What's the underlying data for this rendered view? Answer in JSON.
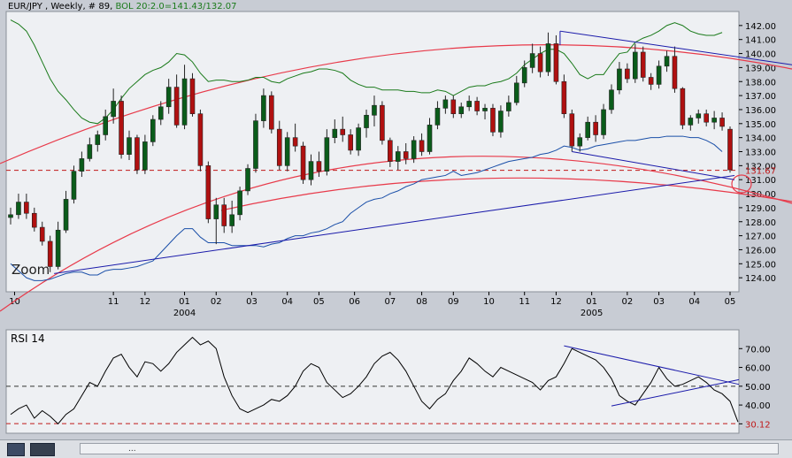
{
  "header": {
    "symbol_text": "EUR/JPY , Weekly, # 89,",
    "bol_text": "BOL 20:2.0=141.43/132.07"
  },
  "zoom_label": "Zoom",
  "rsi_title": "RSI 14",
  "colors": {
    "up": "#0a5c1a",
    "down": "#b01010",
    "bollinger_upper": "#1a7a1a",
    "bollinger_lower": "#1a4fa8",
    "trendline": "#1a1aaa",
    "arc": "#e83a4a",
    "level": "#c01818"
  },
  "taskbar": {
    "dots": "..."
  },
  "chart_data": [
    {
      "type": "candlestick",
      "title": "EUR/JPY , Weekly, # 89,",
      "indicator": "BOL 20:2.0=141.43/132.07",
      "ylim": [
        123,
        143
      ],
      "yticks": [
        124,
        125,
        126,
        127,
        128,
        129,
        130,
        131,
        132,
        133,
        134,
        135,
        136,
        137,
        138,
        139,
        140,
        141,
        142
      ],
      "ytick_labels": [
        "124.00",
        "125.00",
        "126.00",
        "127.00",
        "128.00",
        "129.00",
        "130.00",
        "131.00",
        "132.00",
        "133.00",
        "134.00",
        "135.00",
        "136.00",
        "137.00",
        "138.00",
        "139.00",
        "140.00",
        "141.00",
        "142.00"
      ],
      "xtick_labels": [
        "10",
        "11",
        "12",
        "01",
        "02",
        "03",
        "04",
        "05",
        "06",
        "07",
        "08",
        "09",
        "10",
        "11",
        "12",
        "01",
        "02",
        "03",
        "04",
        "05"
      ],
      "xtick_weeks": [
        0.5,
        13,
        17,
        22,
        26,
        30.5,
        35,
        39,
        43.5,
        48,
        52,
        56,
        60.5,
        65,
        69,
        73.5,
        78,
        82,
        86.5,
        91
      ],
      "year_labels": [
        {
          "text": "2004",
          "week": 22
        },
        {
          "text": "2005",
          "week": 73.5
        }
      ],
      "current_label": "131.67",
      "current_level": 131.67,
      "candles": [
        {
          "o": 128.3,
          "h": 129.0,
          "l": 127.8,
          "c": 128.5
        },
        {
          "o": 128.5,
          "h": 130.0,
          "l": 128.2,
          "c": 129.4
        },
        {
          "o": 129.4,
          "h": 130.0,
          "l": 128.2,
          "c": 128.6
        },
        {
          "o": 128.6,
          "h": 129.0,
          "l": 127.3,
          "c": 127.6
        },
        {
          "o": 127.6,
          "h": 128.0,
          "l": 126.3,
          "c": 126.6
        },
        {
          "o": 126.6,
          "h": 127.0,
          "l": 124.4,
          "c": 124.8
        },
        {
          "o": 124.8,
          "h": 128.0,
          "l": 124.6,
          "c": 127.4
        },
        {
          "o": 127.4,
          "h": 130.2,
          "l": 127.2,
          "c": 129.6
        },
        {
          "o": 129.6,
          "h": 132.0,
          "l": 129.3,
          "c": 131.6
        },
        {
          "o": 131.6,
          "h": 133.0,
          "l": 131.2,
          "c": 132.5
        },
        {
          "o": 132.5,
          "h": 134.0,
          "l": 132.3,
          "c": 133.5
        },
        {
          "o": 133.5,
          "h": 134.5,
          "l": 133.0,
          "c": 134.2
        },
        {
          "o": 134.2,
          "h": 136.0,
          "l": 133.8,
          "c": 135.5
        },
        {
          "o": 135.5,
          "h": 137.5,
          "l": 135.0,
          "c": 136.6
        },
        {
          "o": 136.6,
          "h": 137.0,
          "l": 132.5,
          "c": 132.8
        },
        {
          "o": 132.8,
          "h": 134.5,
          "l": 132.4,
          "c": 134.0
        },
        {
          "o": 134.0,
          "h": 134.2,
          "l": 131.4,
          "c": 131.7
        },
        {
          "o": 131.7,
          "h": 134.2,
          "l": 131.4,
          "c": 133.7
        },
        {
          "o": 133.7,
          "h": 135.6,
          "l": 133.4,
          "c": 135.3
        },
        {
          "o": 135.3,
          "h": 136.6,
          "l": 134.9,
          "c": 136.2
        },
        {
          "o": 136.2,
          "h": 138.2,
          "l": 135.7,
          "c": 137.6
        },
        {
          "o": 137.6,
          "h": 138.5,
          "l": 134.7,
          "c": 134.9
        },
        {
          "o": 134.9,
          "h": 139.2,
          "l": 134.6,
          "c": 138.2
        },
        {
          "o": 138.2,
          "h": 138.6,
          "l": 135.5,
          "c": 135.7
        },
        {
          "o": 135.7,
          "h": 136.0,
          "l": 131.6,
          "c": 132.0
        },
        {
          "o": 132.0,
          "h": 132.3,
          "l": 127.9,
          "c": 128.2
        },
        {
          "o": 128.2,
          "h": 129.7,
          "l": 126.4,
          "c": 129.2
        },
        {
          "o": 129.2,
          "h": 129.7,
          "l": 127.2,
          "c": 127.7
        },
        {
          "o": 127.7,
          "h": 129.5,
          "l": 127.2,
          "c": 128.5
        },
        {
          "o": 128.5,
          "h": 130.5,
          "l": 128.1,
          "c": 130.2
        },
        {
          "o": 130.2,
          "h": 132.1,
          "l": 129.9,
          "c": 131.8
        },
        {
          "o": 131.8,
          "h": 135.7,
          "l": 131.5,
          "c": 135.2
        },
        {
          "o": 135.2,
          "h": 137.5,
          "l": 134.7,
          "c": 137.0
        },
        {
          "o": 137.0,
          "h": 137.3,
          "l": 134.3,
          "c": 134.6
        },
        {
          "o": 134.6,
          "h": 135.2,
          "l": 131.7,
          "c": 132.0
        },
        {
          "o": 132.0,
          "h": 134.4,
          "l": 131.6,
          "c": 134.0
        },
        {
          "o": 134.0,
          "h": 135.0,
          "l": 133.0,
          "c": 133.4
        },
        {
          "o": 133.4,
          "h": 133.7,
          "l": 130.7,
          "c": 131.0
        },
        {
          "o": 131.0,
          "h": 132.8,
          "l": 130.6,
          "c": 132.3
        },
        {
          "o": 132.3,
          "h": 133.0,
          "l": 131.2,
          "c": 131.6
        },
        {
          "o": 131.6,
          "h": 134.6,
          "l": 131.3,
          "c": 134.0
        },
        {
          "o": 134.0,
          "h": 135.3,
          "l": 133.6,
          "c": 134.6
        },
        {
          "o": 134.6,
          "h": 135.5,
          "l": 133.7,
          "c": 134.2
        },
        {
          "o": 134.2,
          "h": 134.6,
          "l": 132.8,
          "c": 133.1
        },
        {
          "o": 133.1,
          "h": 135.0,
          "l": 132.7,
          "c": 134.7
        },
        {
          "o": 134.7,
          "h": 136.0,
          "l": 134.0,
          "c": 135.6
        },
        {
          "o": 135.6,
          "h": 137.0,
          "l": 134.8,
          "c": 136.3
        },
        {
          "o": 136.3,
          "h": 136.6,
          "l": 133.5,
          "c": 133.8
        },
        {
          "o": 133.8,
          "h": 134.0,
          "l": 131.9,
          "c": 132.3
        },
        {
          "o": 132.3,
          "h": 133.4,
          "l": 131.7,
          "c": 133.0
        },
        {
          "o": 133.0,
          "h": 133.6,
          "l": 132.1,
          "c": 132.5
        },
        {
          "o": 132.5,
          "h": 134.1,
          "l": 132.2,
          "c": 133.8
        },
        {
          "o": 133.8,
          "h": 134.3,
          "l": 132.7,
          "c": 133.0
        },
        {
          "o": 133.0,
          "h": 135.4,
          "l": 132.8,
          "c": 134.9
        },
        {
          "o": 134.9,
          "h": 136.6,
          "l": 134.6,
          "c": 136.1
        },
        {
          "o": 136.1,
          "h": 137.0,
          "l": 135.7,
          "c": 136.7
        },
        {
          "o": 136.7,
          "h": 137.0,
          "l": 135.4,
          "c": 135.7
        },
        {
          "o": 135.7,
          "h": 136.5,
          "l": 135.4,
          "c": 136.2
        },
        {
          "o": 136.2,
          "h": 137.0,
          "l": 135.9,
          "c": 136.6
        },
        {
          "o": 136.6,
          "h": 136.9,
          "l": 135.6,
          "c": 135.9
        },
        {
          "o": 135.9,
          "h": 136.4,
          "l": 135.3,
          "c": 136.1
        },
        {
          "o": 136.1,
          "h": 136.4,
          "l": 134.1,
          "c": 134.4
        },
        {
          "o": 134.4,
          "h": 136.3,
          "l": 134.0,
          "c": 135.9
        },
        {
          "o": 135.9,
          "h": 137.0,
          "l": 135.5,
          "c": 136.5
        },
        {
          "o": 136.5,
          "h": 138.4,
          "l": 136.3,
          "c": 137.9
        },
        {
          "o": 137.9,
          "h": 139.5,
          "l": 137.6,
          "c": 139.0
        },
        {
          "o": 139.0,
          "h": 140.7,
          "l": 138.6,
          "c": 140.0
        },
        {
          "o": 140.0,
          "h": 140.5,
          "l": 138.3,
          "c": 138.7
        },
        {
          "o": 138.7,
          "h": 141.5,
          "l": 138.4,
          "c": 140.7
        },
        {
          "o": 140.7,
          "h": 141.3,
          "l": 137.8,
          "c": 138.0
        },
        {
          "o": 138.0,
          "h": 138.5,
          "l": 135.4,
          "c": 135.7
        },
        {
          "o": 135.7,
          "h": 136.0,
          "l": 133.0,
          "c": 133.4
        },
        {
          "o": 133.4,
          "h": 134.3,
          "l": 133.0,
          "c": 134.0
        },
        {
          "o": 134.0,
          "h": 135.5,
          "l": 133.8,
          "c": 135.1
        },
        {
          "o": 135.1,
          "h": 135.6,
          "l": 133.7,
          "c": 134.2
        },
        {
          "o": 134.2,
          "h": 136.4,
          "l": 133.9,
          "c": 136.0
        },
        {
          "o": 136.0,
          "h": 137.8,
          "l": 135.7,
          "c": 137.4
        },
        {
          "o": 137.4,
          "h": 139.4,
          "l": 137.1,
          "c": 138.9
        },
        {
          "o": 138.9,
          "h": 139.3,
          "l": 137.9,
          "c": 138.2
        },
        {
          "o": 138.2,
          "h": 140.7,
          "l": 137.9,
          "c": 140.1
        },
        {
          "o": 140.1,
          "h": 140.5,
          "l": 138.0,
          "c": 138.3
        },
        {
          "o": 138.3,
          "h": 138.6,
          "l": 137.4,
          "c": 137.8
        },
        {
          "o": 137.8,
          "h": 139.5,
          "l": 137.5,
          "c": 139.1
        },
        {
          "o": 139.1,
          "h": 140.2,
          "l": 138.7,
          "c": 139.8
        },
        {
          "o": 139.8,
          "h": 140.5,
          "l": 137.2,
          "c": 137.5
        },
        {
          "o": 137.5,
          "h": 137.6,
          "l": 134.6,
          "c": 134.9
        },
        {
          "o": 134.9,
          "h": 135.6,
          "l": 134.5,
          "c": 135.4
        },
        {
          "o": 135.4,
          "h": 136.0,
          "l": 135.0,
          "c": 135.7
        },
        {
          "o": 135.7,
          "h": 136.0,
          "l": 134.8,
          "c": 135.1
        },
        {
          "o": 135.1,
          "h": 135.9,
          "l": 134.6,
          "c": 135.4
        },
        {
          "o": 135.4,
          "h": 135.8,
          "l": 134.5,
          "c": 134.8
        },
        {
          "o": 134.6,
          "h": 134.8,
          "l": 131.5,
          "c": 131.7
        }
      ],
      "bollinger_upper": [
        142.4,
        142.1,
        141.6,
        140.6,
        139.4,
        138.2,
        137.3,
        136.7,
        136.0,
        135.4,
        135.1,
        135.0,
        135.4,
        136.0,
        136.8,
        137.5,
        138.0,
        138.5,
        138.8,
        139.0,
        139.4,
        140.0,
        139.9,
        139.4,
        138.6,
        138.0,
        138.1,
        138.1,
        138.0,
        138.0,
        138.1,
        138.3,
        138.3,
        138.0,
        137.9,
        138.2,
        138.4,
        138.6,
        138.7,
        138.9,
        138.9,
        138.8,
        138.6,
        138.1,
        137.8,
        137.6,
        137.6,
        137.4,
        137.4,
        137.4,
        137.3,
        137.3,
        137.2,
        137.2,
        137.4,
        137.3,
        137.0,
        137.3,
        137.6,
        137.7,
        137.7,
        137.9,
        138.0,
        138.2,
        138.6,
        139.2,
        139.6,
        140.0,
        140.3,
        140.3,
        140.0,
        139.3,
        138.5,
        138.2,
        138.5,
        138.5,
        139.3,
        140.0,
        140.1,
        140.8,
        141.1,
        141.3,
        141.6,
        142.0,
        142.2,
        142.0,
        141.6,
        141.4,
        141.3,
        141.3,
        141.5
      ],
      "bollinger_lower": [
        125.0,
        124.5,
        124.0,
        123.8,
        123.8,
        123.9,
        124.1,
        124.3,
        124.4,
        124.4,
        124.2,
        124.2,
        124.5,
        124.6,
        124.6,
        124.7,
        124.8,
        125.0,
        125.2,
        125.8,
        126.4,
        127.0,
        127.5,
        127.5,
        126.9,
        126.5,
        126.5,
        126.5,
        126.3,
        126.3,
        126.3,
        126.3,
        126.2,
        126.4,
        126.5,
        126.8,
        127.0,
        127.0,
        127.2,
        127.3,
        127.5,
        127.8,
        128.0,
        128.6,
        129.0,
        129.4,
        129.6,
        129.7,
        130.0,
        130.2,
        130.5,
        130.7,
        131.0,
        131.1,
        131.2,
        131.3,
        131.6,
        131.3,
        131.4,
        131.5,
        131.7,
        131.9,
        132.1,
        132.3,
        132.4,
        132.5,
        132.6,
        132.8,
        132.9,
        133.1,
        133.4,
        133.3,
        133.1,
        133.2,
        133.4,
        133.5,
        133.6,
        133.7,
        133.8,
        133.8,
        133.9,
        134.0,
        134.0,
        134.1,
        134.1,
        134.1,
        134.0,
        134.0,
        133.8,
        133.5,
        133.0
      ]
    },
    {
      "type": "line",
      "title": "RSI 14",
      "ylim": [
        25,
        80
      ],
      "yticks": [
        30,
        40,
        50,
        60,
        70
      ],
      "ytick_labels": [
        "30.12",
        "40.00",
        "50.00",
        "60.00",
        "70.00"
      ],
      "current_label": "30.12",
      "current_value": 30.12,
      "midline": 50,
      "values": [
        35,
        38,
        40,
        33,
        37,
        34,
        30,
        35,
        38,
        45,
        52,
        50,
        58,
        65,
        67,
        60,
        55,
        63,
        62,
        58,
        62,
        68,
        72,
        76,
        72,
        74,
        70,
        55,
        45,
        38,
        36,
        38,
        40,
        43,
        42,
        45,
        50,
        58,
        62,
        60,
        52,
        48,
        44,
        46,
        50,
        55,
        62,
        66,
        68,
        64,
        58,
        50,
        42,
        38,
        43,
        46,
        53,
        58,
        65,
        62,
        58,
        55,
        60,
        58,
        56,
        54,
        52,
        48,
        53,
        55,
        62,
        70,
        68,
        66,
        64,
        60,
        54,
        45,
        42,
        40,
        46,
        52,
        60,
        54,
        50,
        51,
        53,
        55,
        52,
        48,
        46,
        42,
        31
      ]
    }
  ]
}
